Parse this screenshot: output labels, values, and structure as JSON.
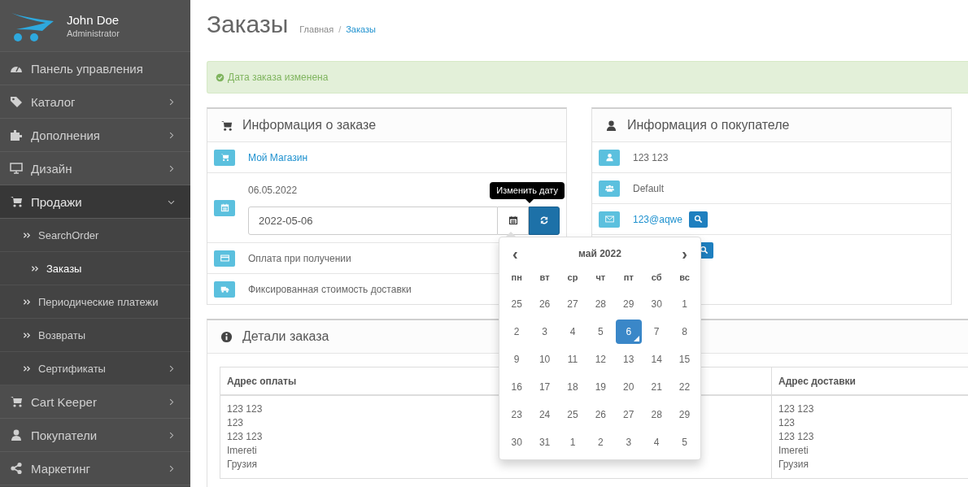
{
  "sidebar": {
    "user": {
      "name": "John Doe",
      "role": "Administrator"
    },
    "items": [
      {
        "label": "Панель управления",
        "kind": "link",
        "expanded": false
      },
      {
        "label": "Каталог",
        "kind": "menu",
        "expanded": false
      },
      {
        "label": "Дополнения",
        "kind": "menu",
        "expanded": false
      },
      {
        "label": "Дизайн",
        "kind": "menu",
        "expanded": false
      },
      {
        "label": "Продажи",
        "kind": "menu",
        "expanded": true,
        "children": [
          {
            "label": "SearchOrder",
            "kind": "link",
            "expanded": false,
            "selected": false
          },
          {
            "label": "Заказы",
            "kind": "link",
            "expanded": false,
            "selected": true
          },
          {
            "label": "Периодические платежи",
            "kind": "link",
            "expanded": false,
            "selected": false
          },
          {
            "label": "Возвраты",
            "kind": "link",
            "expanded": false,
            "selected": false
          },
          {
            "label": "Сертификаты",
            "kind": "menu",
            "expanded": false,
            "selected": false
          }
        ]
      },
      {
        "label": "Cart Keeper",
        "kind": "menu",
        "expanded": false
      },
      {
        "label": "Покупатели",
        "kind": "menu",
        "expanded": false
      },
      {
        "label": "Маркетинг",
        "kind": "menu",
        "expanded": false
      }
    ]
  },
  "page": {
    "title": "Заказы",
    "separator": "/",
    "breadcrumb": [
      {
        "label": "Главная",
        "selected": false
      },
      {
        "label": "Заказы",
        "selected": true
      }
    ]
  },
  "alert": {
    "kind": "success",
    "text": "Дата заказа изменена"
  },
  "order_info": {
    "title": "Информация о заказе",
    "rows": [
      {
        "kind": "link",
        "text": "Мой Магазин"
      },
      {
        "kind": "date",
        "label": "06.05.2022",
        "value": "2022-05-06",
        "tooltip": "Изменить дату"
      },
      {
        "kind": "text",
        "text": "Оплата при получении"
      },
      {
        "kind": "text",
        "text": "Фиксированная стоимость доставки"
      }
    ]
  },
  "datepicker": {
    "month": "май 2022",
    "prev": "‹",
    "next": "›",
    "weekdays": [
      "пн",
      "вт",
      "ср",
      "чт",
      "пт",
      "сб",
      "вс"
    ],
    "weeks": [
      [
        {
          "day": "25",
          "selected": false
        },
        {
          "day": "26",
          "selected": false
        },
        {
          "day": "27",
          "selected": false
        },
        {
          "day": "28",
          "selected": false
        },
        {
          "day": "29",
          "selected": false
        },
        {
          "day": "30",
          "selected": false
        },
        {
          "day": "1",
          "selected": false
        }
      ],
      [
        {
          "day": "2",
          "selected": false
        },
        {
          "day": "3",
          "selected": false
        },
        {
          "day": "4",
          "selected": false
        },
        {
          "day": "5",
          "selected": false
        },
        {
          "day": "6",
          "selected": true
        },
        {
          "day": "7",
          "selected": false
        },
        {
          "day": "8",
          "selected": false
        }
      ],
      [
        {
          "day": "9",
          "selected": false
        },
        {
          "day": "10",
          "selected": false
        },
        {
          "day": "11",
          "selected": false
        },
        {
          "day": "12",
          "selected": false
        },
        {
          "day": "13",
          "selected": false
        },
        {
          "day": "14",
          "selected": false
        },
        {
          "day": "15",
          "selected": false
        }
      ],
      [
        {
          "day": "16",
          "selected": false
        },
        {
          "day": "17",
          "selected": false
        },
        {
          "day": "18",
          "selected": false
        },
        {
          "day": "19",
          "selected": false
        },
        {
          "day": "20",
          "selected": false
        },
        {
          "day": "21",
          "selected": false
        },
        {
          "day": "22",
          "selected": false
        }
      ],
      [
        {
          "day": "23",
          "selected": false
        },
        {
          "day": "24",
          "selected": false
        },
        {
          "day": "25",
          "selected": false
        },
        {
          "day": "26",
          "selected": false
        },
        {
          "day": "27",
          "selected": false
        },
        {
          "day": "28",
          "selected": false
        },
        {
          "day": "29",
          "selected": false
        }
      ],
      [
        {
          "day": "30",
          "selected": false
        },
        {
          "day": "31",
          "selected": false
        },
        {
          "day": "1",
          "selected": false
        },
        {
          "day": "2",
          "selected": false
        },
        {
          "day": "3",
          "selected": false
        },
        {
          "day": "4",
          "selected": false
        },
        {
          "day": "5",
          "selected": false
        }
      ]
    ]
  },
  "customer_info": {
    "title": "Информация о покупателе",
    "rows": [
      {
        "kind": "text",
        "text": "123 123",
        "search": false
      },
      {
        "kind": "text",
        "text": "Default",
        "search": false
      },
      {
        "kind": "link",
        "text": "123@aqwe",
        "search": true
      },
      {
        "kind": "covered",
        "search": true
      }
    ]
  },
  "details": {
    "title": "Детали заказа",
    "columns": [
      "Адрес оплаты",
      "Адрес доставки"
    ],
    "rows": [
      [
        "123 123\n123\n123 123\nImereti\nГрузия",
        "123 123\n123\n123 123\nImereti\nГрузия"
      ]
    ]
  }
}
